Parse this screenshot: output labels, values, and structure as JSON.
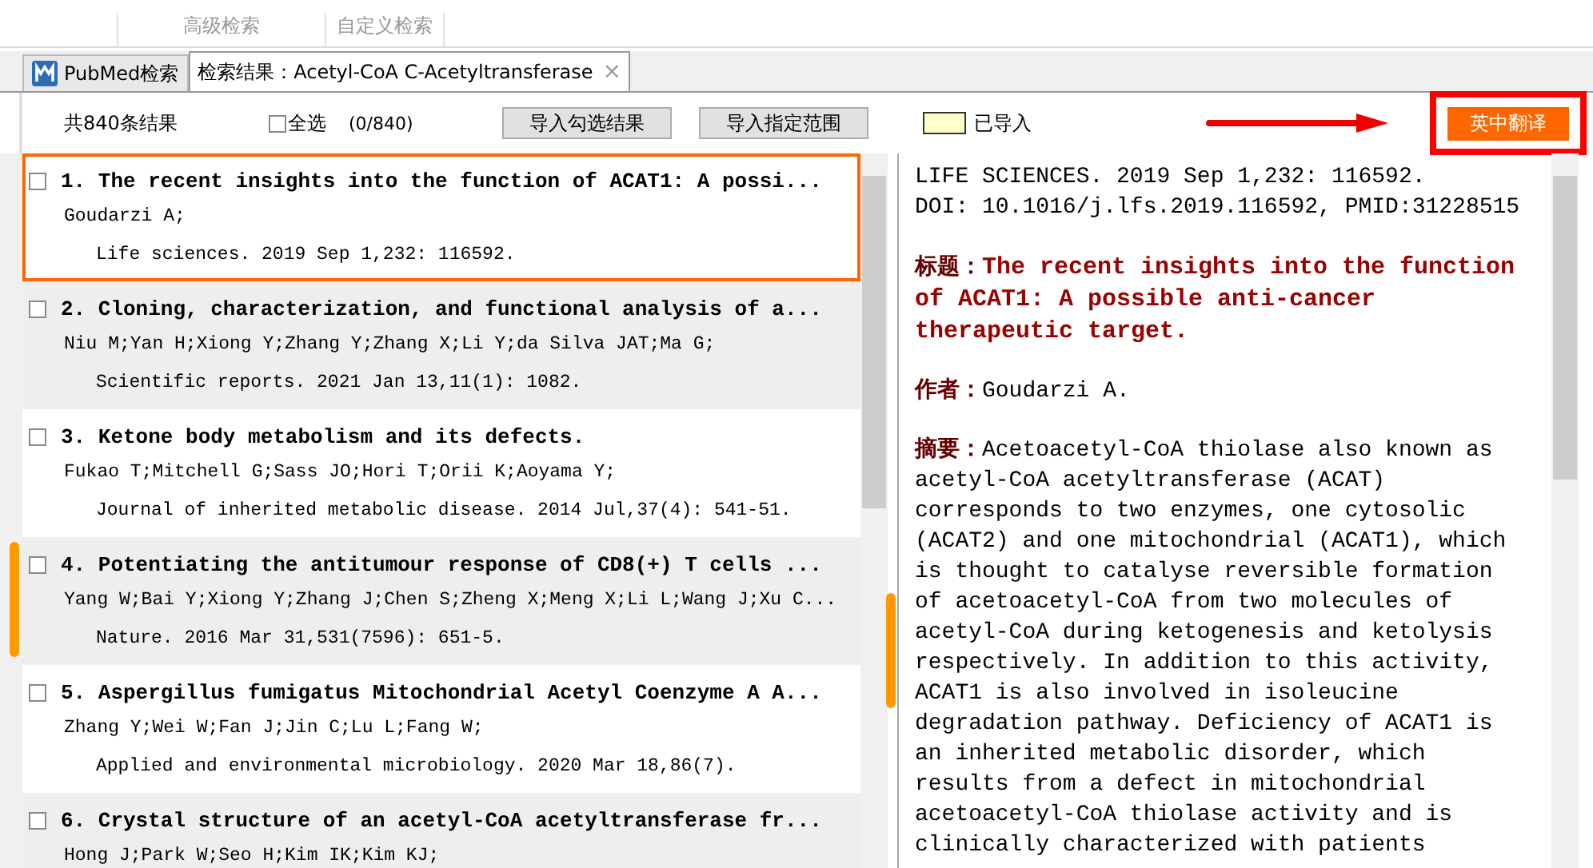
{
  "top_tabs": [
    {
      "label": "高级检索"
    },
    {
      "label": "自定义检索"
    }
  ],
  "doc_tabs": [
    {
      "label": "PubMed检索",
      "selected": false,
      "icon": true
    },
    {
      "label": "检索结果：Acetyl-CoA C-Acetyltransferase",
      "selected": true,
      "icon": false,
      "close": "×"
    }
  ],
  "toolbar": {
    "total": "共840条结果",
    "select_all": {
      "label": "全选",
      "checked": false
    },
    "count": "(0/840)",
    "buttons": [
      "导入勾选结果",
      "导入指定范围"
    ],
    "legend": {
      "label": "已导入",
      "color": "#ffffc8"
    },
    "translate_button": "英中翻译"
  },
  "results": [
    {
      "number": "1.",
      "title": "The recent insights into the function of ACAT1: A possi...",
      "authors": "Goudarzi A;",
      "journal": "Life sciences. 2019 Sep 1,232: 116592.",
      "checked": false,
      "selected": true
    },
    {
      "number": "2.",
      "title": "Cloning, characterization, and functional analysis of a...",
      "authors": "Niu M;Yan H;Xiong Y;Zhang Y;Zhang X;Li Y;da Silva JAT;Ma G;",
      "journal": "Scientific reports. 2021 Jan 13,11(1): 1082.",
      "checked": false,
      "selected": false
    },
    {
      "number": "3.",
      "title": "Ketone body metabolism and its defects.",
      "authors": "Fukao T;Mitchell G;Sass JO;Hori T;Orii K;Aoyama Y;",
      "journal": "Journal of inherited metabolic disease. 2014 Jul,37(4): 541-51.",
      "checked": false,
      "selected": false
    },
    {
      "number": "4.",
      "title": "Potentiating the antitumour response of CD8(+) T cells ...",
      "authors": "Yang W;Bai Y;Xiong Y;Zhang J;Chen S;Zheng X;Meng X;Li L;Wang J;Xu C...",
      "journal": "Nature. 2016 Mar 31,531(7596): 651-5.",
      "checked": false,
      "selected": false
    },
    {
      "number": "5.",
      "title": "Aspergillus fumigatus Mitochondrial Acetyl Coenzyme A A...",
      "authors": "Zhang Y;Wei W;Fan J;Jin C;Lu L;Fang W;",
      "journal": "Applied and environmental microbiology. 2020 Mar 18,86(7).",
      "checked": false,
      "selected": false
    },
    {
      "number": "6.",
      "title": "Crystal structure of an acetyl-CoA acetyltransferase fr...",
      "authors": "Hong J;Park W;Seo H;Kim IK;Kim KJ;",
      "checked": false,
      "selected": false
    }
  ],
  "detail": {
    "citation": "LIFE SCIENCES. 2019 Sep 1,232: 116592.",
    "doi": "DOI: 10.1016/j.lfs.2019.116592, PMID:31228515",
    "title_label": "标题：",
    "title": "The recent insights into the function of ACAT1: A possible anti-cancer therapeutic target.",
    "author_label": "作者：",
    "authors": "Goudarzi A.",
    "abstract_label": "摘要：",
    "abstract": "Acetoacetyl-CoA thiolase also known as acetyl-CoA acetyltransferase (ACAT) corresponds to two enzymes, one cytosolic (ACAT2) and one mitochondrial (ACAT1), which is thought to catalyse reversible formation of acetoacetyl-CoA from two molecules of acetyl-CoA during ketogenesis and ketolysis respectively. In addition to this activity, ACAT1 is also involved in isoleucine degradation pathway. Deficiency of ACAT1 is an inherited metabolic disorder, which results from a defect in mitochondrial acetoacetyl-CoA thiolase activity and is clinically characterized with patients"
  }
}
